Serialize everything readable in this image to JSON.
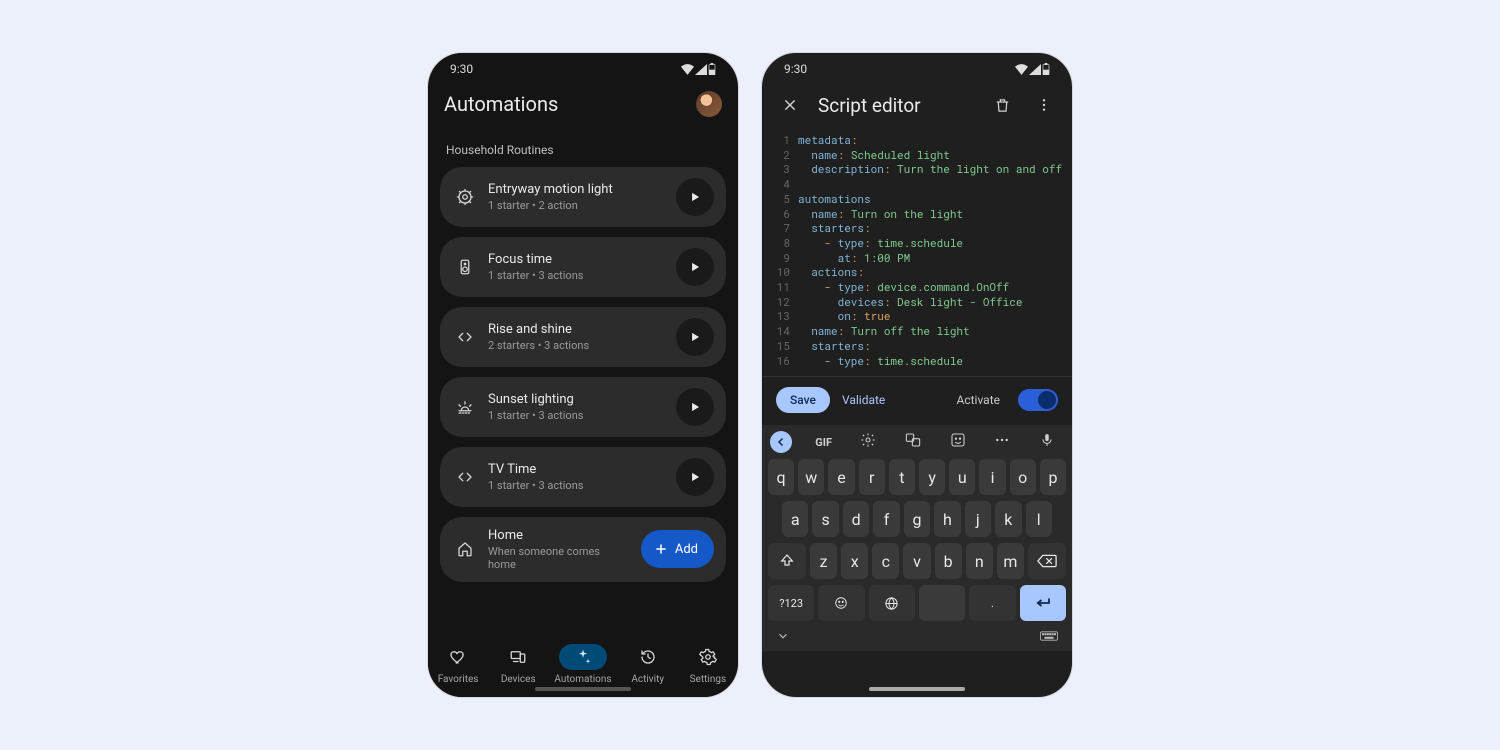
{
  "status": {
    "time": "9:30"
  },
  "automations": {
    "title": "Automations",
    "section": "Household Routines",
    "routines": [
      {
        "icon": "gear",
        "title": "Entryway motion light",
        "subtitle": "1 starter • 2 action",
        "play": true
      },
      {
        "icon": "speaker",
        "title": "Focus time",
        "subtitle": "1 starter • 3 actions",
        "play": true
      },
      {
        "icon": "code",
        "title": "Rise and shine",
        "subtitle": "2 starters • 3 actions",
        "play": true
      },
      {
        "icon": "sunset",
        "title": "Sunset lighting",
        "subtitle": "1 starter • 3 actions",
        "play": true
      },
      {
        "icon": "code",
        "title": "TV Time",
        "subtitle": "1 starter • 3 actions",
        "play": true
      },
      {
        "icon": "house",
        "title": "Home",
        "subtitle": "When someone comes home",
        "add": true
      }
    ],
    "add_label": "Add",
    "nav": [
      {
        "icon": "heart",
        "label": "Favorites"
      },
      {
        "icon": "devices",
        "label": "Devices"
      },
      {
        "icon": "sparkle",
        "label": "Automations",
        "active": true
      },
      {
        "icon": "history",
        "label": "Activity"
      },
      {
        "icon": "settings",
        "label": "Settings"
      }
    ]
  },
  "editor": {
    "title": "Script editor",
    "footer": {
      "save": "Save",
      "validate": "Validate",
      "activate": "Activate",
      "activated": true
    },
    "code": [
      {
        "tokens": [
          [
            "key",
            "metadata"
          ],
          [
            "p",
            ":"
          ]
        ]
      },
      {
        "tokens": [
          [
            "key",
            "  name"
          ],
          [
            "p",
            ": "
          ],
          [
            "str",
            "Scheduled light"
          ]
        ]
      },
      {
        "tokens": [
          [
            "key",
            "  description"
          ],
          [
            "p",
            ": "
          ],
          [
            "str",
            "Turn the light on and off"
          ]
        ]
      },
      {
        "tokens": []
      },
      {
        "tokens": [
          [
            "key",
            "automations"
          ]
        ]
      },
      {
        "tokens": [
          [
            "key",
            "  name"
          ],
          [
            "p",
            ": "
          ],
          [
            "str",
            "Turn on the light"
          ]
        ]
      },
      {
        "tokens": [
          [
            "key",
            "  starters"
          ],
          [
            "p",
            ":"
          ]
        ]
      },
      {
        "tokens": [
          [
            "p",
            "    - "
          ],
          [
            "key",
            "type"
          ],
          [
            "p",
            ": "
          ],
          [
            "str",
            "time.schedule"
          ]
        ]
      },
      {
        "tokens": [
          [
            "key",
            "      at"
          ],
          [
            "p",
            ": "
          ],
          [
            "str",
            "1:00 PM"
          ]
        ]
      },
      {
        "tokens": [
          [
            "key",
            "  actions"
          ],
          [
            "p",
            ":"
          ]
        ]
      },
      {
        "tokens": [
          [
            "p",
            "    - "
          ],
          [
            "key",
            "type"
          ],
          [
            "p",
            ": "
          ],
          [
            "str",
            "device.command.OnOff"
          ]
        ]
      },
      {
        "tokens": [
          [
            "key",
            "      devices"
          ],
          [
            "p",
            ": "
          ],
          [
            "str",
            "Desk light - Office"
          ]
        ]
      },
      {
        "tokens": [
          [
            "key",
            "      on"
          ],
          [
            "p",
            ": "
          ],
          [
            "bool",
            "true"
          ]
        ]
      },
      {
        "tokens": [
          [
            "key",
            "  name"
          ],
          [
            "p",
            ": "
          ],
          [
            "str",
            "Turn off the light"
          ]
        ]
      },
      {
        "tokens": [
          [
            "key",
            "  starters"
          ],
          [
            "p",
            ":"
          ]
        ]
      },
      {
        "tokens": [
          [
            "p",
            "    - "
          ],
          [
            "key",
            "type"
          ],
          [
            "p",
            ": "
          ],
          [
            "str",
            "time.schedule"
          ]
        ]
      }
    ]
  },
  "keyboard": {
    "top": [
      "GIF",
      "gear",
      "translate",
      "sticker",
      "dots",
      "mic"
    ],
    "rows": [
      [
        "q",
        "w",
        "e",
        "r",
        "t",
        "y",
        "u",
        "i",
        "o",
        "p"
      ],
      [
        "a",
        "s",
        "d",
        "f",
        "g",
        "h",
        "j",
        "k",
        "l"
      ],
      [
        "z",
        "x",
        "c",
        "v",
        "b",
        "n",
        "m"
      ]
    ],
    "symbols_label": "?123",
    "period": "."
  },
  "colors": {
    "phone_bg_dark": "#141414",
    "phone_bg_grey": "#1f1f1f",
    "card_bg": "#2c2c2c",
    "primary_blue": "#1558c7",
    "accent_light_blue": "#a9c7ff",
    "nav_active_bg": "#004a77"
  }
}
